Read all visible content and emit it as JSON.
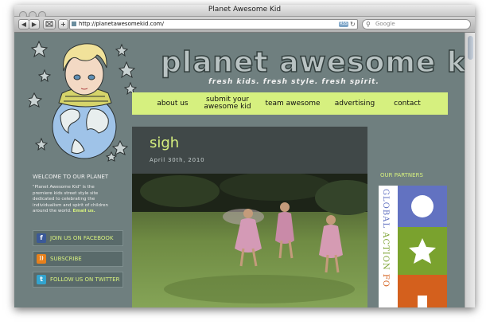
{
  "window": {
    "title": "Planet Awesome Kid"
  },
  "browser": {
    "back": "◀",
    "forward": "▶",
    "add": "+",
    "url": "http://planetawesomekid.com/",
    "rss": "RSS",
    "reload": "↻",
    "search_placeholder": "Google"
  },
  "site": {
    "logo": "planet awesome kid",
    "tagline": "fresh kids. fresh style. fresh spirit."
  },
  "nav": {
    "about": "about us",
    "submit_line1": "submit your",
    "submit_line2": "awesome kid",
    "team": "team awesome",
    "advertising": "advertising",
    "contact": "contact"
  },
  "post": {
    "title": "sigh",
    "date": "April 30th, 2010"
  },
  "welcome": {
    "heading": "WELCOME TO OUR PLANET",
    "text": "\"Planet Awesome Kid\" is the premiere kids street style site dedicated to celebrating the individualism and spirit of children around the world.",
    "link": "Email us."
  },
  "social": {
    "facebook": {
      "icon": "facebook-icon",
      "glyph": "f",
      "label": "JOIN US ON FACEBOOK"
    },
    "rss": {
      "icon": "rss-icon",
      "glyph": "))",
      "label": "SUBSCRIBE"
    },
    "twitter": {
      "icon": "twitter-icon",
      "glyph": "t",
      "label": "FOLLOW US ON TWITTER"
    }
  },
  "partners": {
    "heading": "OUR PARTNERS",
    "banner_text": "GLOBAL ACTION FO"
  },
  "colors": {
    "page_bg": "#6f7f7f",
    "accent": "#d6f07f",
    "post_bg": "#404848",
    "partner_blue": "#6272c1",
    "partner_green": "#7aa22e",
    "partner_orange": "#d4601d"
  }
}
